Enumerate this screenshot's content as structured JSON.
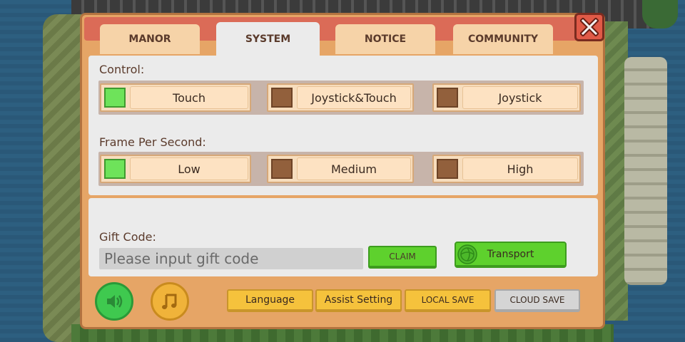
{
  "tabs": [
    {
      "label": "MANOR",
      "active": false
    },
    {
      "label": "SYSTEM",
      "active": true
    },
    {
      "label": "NOTICE",
      "active": false
    },
    {
      "label": "COMMUNITY",
      "active": false
    }
  ],
  "control": {
    "label": "Control:",
    "options": [
      {
        "label": "Touch",
        "selected": true
      },
      {
        "label": "Joystick&Touch",
        "selected": false
      },
      {
        "label": "Joystick",
        "selected": false
      }
    ]
  },
  "fps": {
    "label": "Frame Per Second:",
    "options": [
      {
        "label": "Low",
        "selected": true
      },
      {
        "label": "Medium",
        "selected": false
      },
      {
        "label": "High",
        "selected": false
      }
    ]
  },
  "gift": {
    "label": "Gift Code:",
    "placeholder": "Please input gift code",
    "value": "",
    "claim_label": "CLAIM",
    "transport_label": "Transport"
  },
  "toolbar": {
    "sound_icon": "speaker-icon",
    "music_icon": "music-note-icon",
    "language_label": "Language",
    "assist_label": "Assist Setting",
    "local_save_label": "LOCAL SAVE",
    "cloud_save_label": "CLOUD SAVE"
  },
  "colors": {
    "selected": "#6ee35a",
    "unselected": "#92603c",
    "header": "#db6b57",
    "frame": "#e6a566",
    "green_button": "#5ed12d",
    "yellow_button": "#f5c23c"
  }
}
